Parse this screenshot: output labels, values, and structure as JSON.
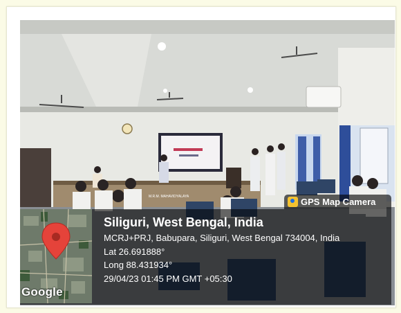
{
  "gps_camera": {
    "app_label": "GPS Map Camera",
    "app_icon": "gps-map-camera-icon",
    "map_provider": "Google",
    "location_title": "Siliguri, West Bengal, India",
    "address": "MCRJ+PRJ, Babupara, Siliguri, West Bengal 734004, India",
    "latitude": "Lat 26.691888°",
    "longitude": "Long 88.431934°",
    "datetime": "29/04/23 01:45 PM GMT +05:30"
  },
  "photo": {
    "stage_banner_text": "M.R.M. MAHAVIDYALAYA"
  },
  "colors": {
    "page_bg": "#fbfbe6",
    "overlay": "rgba(0,0,0,0.58)",
    "map_pin": "#e5433a",
    "app_icon": "#f4c230"
  }
}
